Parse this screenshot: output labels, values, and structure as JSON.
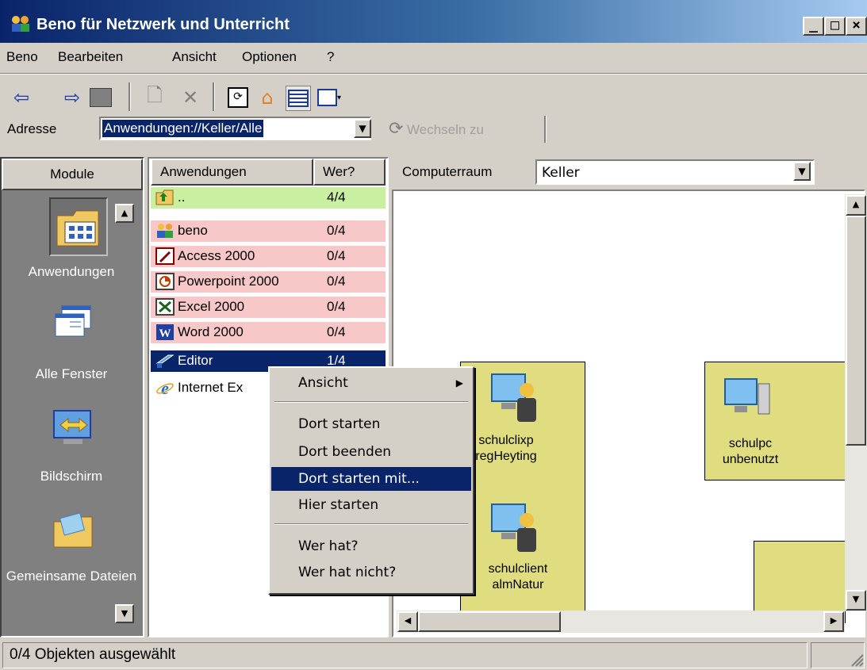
{
  "window": {
    "title": "Beno für Netzwerk und Unterricht",
    "minimize": "_",
    "maximize": "□",
    "close": "×"
  },
  "menu": [
    "Beno",
    "Bearbeiten",
    "Ansicht",
    "Optionen",
    "?"
  ],
  "address": {
    "label": "Adresse",
    "value": "Anwendungen://Keller/Alle",
    "go_label": "Wechseln zu"
  },
  "modules": {
    "header": "Module",
    "items": [
      {
        "label": "Anwendungen",
        "icon": "applications-folder-icon"
      },
      {
        "label": "Alle Fenster",
        "icon": "windows-icon"
      },
      {
        "label": "Bildschirm",
        "icon": "screen-icon"
      },
      {
        "label": "Gemeinsame Dateien",
        "icon": "shared-files-icon"
      }
    ]
  },
  "applist": {
    "col_name": "Anwendungen",
    "col_who": "Wer?",
    "rows": [
      {
        "name": "..",
        "count": "4/4",
        "bg": "#c8f0a0",
        "icon": "folder-up-icon"
      },
      {
        "name": "beno",
        "count": "0/4",
        "bg": "#f8c8c8",
        "icon": "users-icon"
      },
      {
        "name": "Access 2000",
        "count": "0/4",
        "bg": "#f8c8c8",
        "icon": "access-icon"
      },
      {
        "name": "Powerpoint 2000",
        "count": "0/4",
        "bg": "#f8c8c8",
        "icon": "powerpoint-icon"
      },
      {
        "name": "Excel 2000",
        "count": "0/4",
        "bg": "#f8c8c8",
        "icon": "excel-icon"
      },
      {
        "name": "Word 2000",
        "count": "0/4",
        "bg": "#f8c8c8",
        "icon": "word-icon"
      },
      {
        "name": "Editor",
        "count": "1/4",
        "bg": "#0a246a",
        "icon": "notepad-icon"
      },
      {
        "name": "Internet Ex",
        "count": "",
        "bg": "#ffffff",
        "icon": "ie-icon"
      }
    ]
  },
  "room": {
    "label": "Computerraum",
    "value": "Keller"
  },
  "computers": [
    {
      "name": "schulclixp",
      "user": "regHeyting"
    },
    {
      "name": "schulpc",
      "user": "unbenutzt"
    },
    {
      "name": "schulclient",
      "user": "almNatur"
    }
  ],
  "context_menu": {
    "items": [
      "Ansicht",
      "Dort starten",
      "Dort beenden",
      "Dort starten mit...",
      "Hier starten",
      "Wer hat?",
      "Wer hat nicht?"
    ],
    "highlighted": "Dort starten mit..."
  },
  "status": "0/4 Objekten ausgewählt",
  "colors": {
    "selection": "#0a246a",
    "computer_tile": "#e0dc80",
    "running": "#c8f0a0",
    "not_running": "#f8c8c8"
  }
}
